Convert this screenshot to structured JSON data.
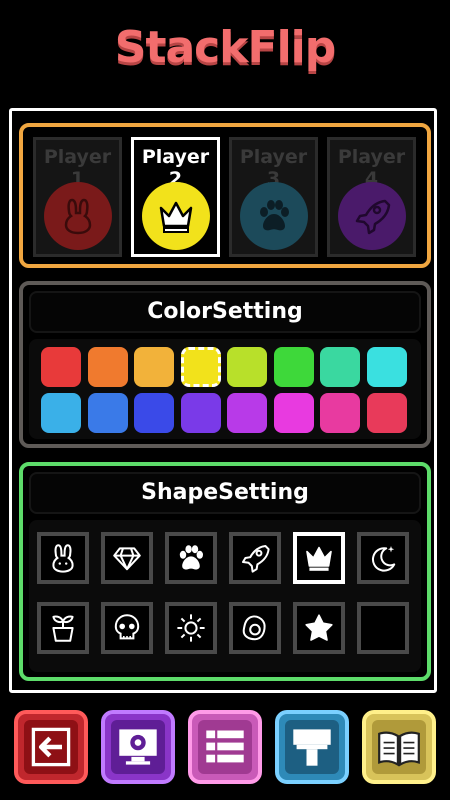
{
  "app": {
    "title": "StackFlip"
  },
  "players": [
    {
      "label": "Player 1",
      "icon": "rabbit-icon",
      "color": "#7a1a1a",
      "selected": false
    },
    {
      "label": "Player 2",
      "icon": "crown-icon",
      "color": "#f2e21b",
      "selected": true
    },
    {
      "label": "Player 3",
      "icon": "paw-icon",
      "color": "#1c4a5a",
      "selected": false
    },
    {
      "label": "Player 4",
      "icon": "rocket-icon",
      "color": "#4a1a6a",
      "selected": false
    }
  ],
  "color_setting": {
    "title": "ColorSetting",
    "colors": [
      "#e83a3a",
      "#f07a2e",
      "#f2b23a",
      "#f2e21b",
      "#b8e02a",
      "#3ed83a",
      "#3ad8a0",
      "#3ae0e0",
      "#3ab0e8",
      "#3a7ae8",
      "#3a4ae8",
      "#7a3ae8",
      "#b83ae8",
      "#e83ae0",
      "#e83aa0",
      "#e83a5a"
    ],
    "selected_index": 3
  },
  "shape_setting": {
    "title": "ShapeSetting",
    "shapes": [
      "rabbit-icon",
      "diamond-icon",
      "paw-icon",
      "rocket-icon",
      "crown-icon",
      "moon-icon",
      "plant-icon",
      "skull-icon",
      "sun-icon",
      "egg-icon",
      "star-icon",
      "empty-slot"
    ],
    "selected_index": 4
  },
  "bottom_bar": [
    {
      "name": "exit-button",
      "icon": "exit-icon",
      "bg": "#c0272d",
      "border": "#ff5a5a"
    },
    {
      "name": "settings-button",
      "icon": "monitor-gear-icon",
      "bg": "#8a35c8",
      "border": "#c07aff"
    },
    {
      "name": "list-button",
      "icon": "list-icon",
      "bg": "#c95ab8",
      "border": "#ff9ae8"
    },
    {
      "name": "paint-button",
      "icon": "paint-roller-icon",
      "bg": "#2e8ab8",
      "border": "#7ad0ff"
    },
    {
      "name": "book-button",
      "icon": "book-icon",
      "bg": "#d8c35a",
      "border": "#fff08a"
    }
  ]
}
